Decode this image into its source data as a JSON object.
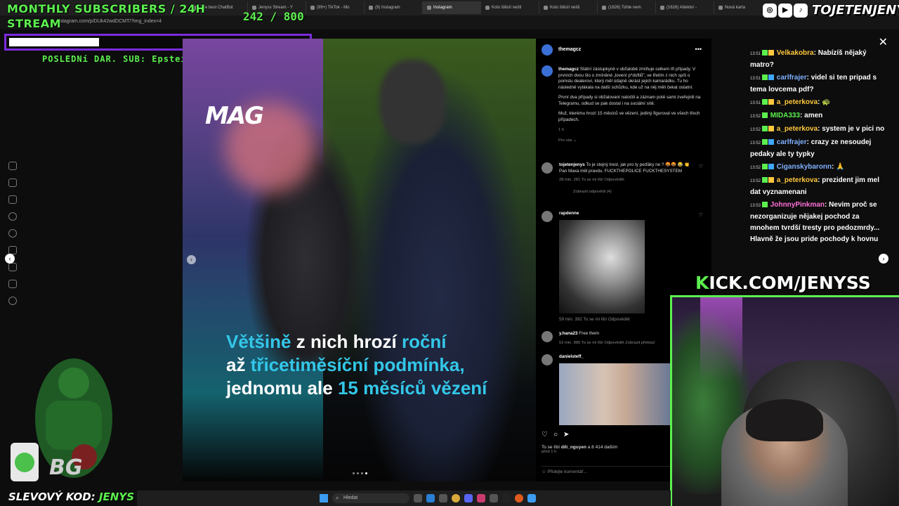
{
  "browser": {
    "tabs": [
      {
        "label": "The best ChatBot",
        "active": false
      },
      {
        "label": "Jenyss Stream - Y",
        "active": false
      },
      {
        "label": "(99+) TikTok - Mo",
        "active": false
      },
      {
        "label": "(9) Instagram",
        "active": false
      },
      {
        "label": "Instagram",
        "active": true
      },
      {
        "label": "Kolo štěstí nešti",
        "active": false
      },
      {
        "label": "Kolo štěstí nešti",
        "active": false
      },
      {
        "label": "(1626) Tohle nem",
        "active": false
      },
      {
        "label": "(1626) Attektor -",
        "active": false
      },
      {
        "label": "Nová karta",
        "active": false
      }
    ],
    "url": "instagram.com/p/DUk42wdDCMT/?img_index=4"
  },
  "overlay": {
    "monthly_title": "MONTHLY SUBSCRIBERS / 24H STREAM",
    "sub_count": "242 / 800",
    "last_donation_label": "POSLEDNí DAR. SUB:",
    "last_donation_user": "EpsteinFanousek",
    "discount_label": "SLEVOVÝ KOD:",
    "discount_code": "JENYS",
    "kick_prefix": "K",
    "kick_url": "ICK.COM/JENYSS",
    "social_handle": "TOJETENJENYS"
  },
  "post": {
    "logo": "MAG",
    "caption_l1_a": "Většině",
    "caption_l1_b": "z nich hrozí",
    "caption_l1_c": "roční",
    "caption_l2_a": "až",
    "caption_l2_b": "třicetiměsíční podmínka,",
    "caption_l3_a": "jednomu ale",
    "caption_l3_b": "15 měsíců vězení"
  },
  "panel": {
    "account": "themagcz",
    "desc_user": "themagcz",
    "desc_p1": "Státní zástupkyně v obžalobě zmiňuje celkem tři případy. V prvních dvou šlo o zmíněné „lovení p*dofilů\", ve třetím z nich spíš o pomstu dealerovi, který měl údajně okrást jejich kamarádku. Tu ho následně vylákala na další schůzku, kde už na něj měli čekat ostatní.",
    "desc_p2": "První dva případy si obžalovaní natočili a záznam poté sami zveřejnili na Telegramu, odkud se pak dostal i na sociální sítě.",
    "desc_p3": "Muž, kterému hrozí 15 měsíců ve vězení, jediný figuroval ve všech třech případech.",
    "desc_time": "1 h",
    "for_you": "Pro vás ⌄",
    "comments": [
      {
        "user": "tojetenjenys",
        "text": "To je stejný trest, jak pro ty peďáky ne ? 🤬🤬 😂 👏 Pan Maxa měl pravdu. FUCKTHEPOLICE FUCKTHESYSTEM",
        "meta": "28 min.   281 To se mi líbí   Odpovědět",
        "replies": "Zobrazit odpovědi (4)"
      },
      {
        "user": "rapdenne",
        "text": "",
        "meta": "59 min.   392 To se mi líbí   Odpovědět"
      },
      {
        "user": "y.hana23",
        "text": "Free them",
        "meta": "52 min.   886 To se mi líbí   Odpovědět   Zobrazit překlad"
      },
      {
        "user": "danielsteff_",
        "text": "",
        "meta": ""
      }
    ],
    "likes_prefix": "To se líbí",
    "likes_user": "dili_nguyen",
    "likes_suffix": "a 8 414 dalším",
    "likes_time": "před 1 h",
    "add_comment_placeholder": "Přidejte komentář..."
  },
  "chat": [
    {
      "time": "13:51",
      "user": "Velkakobra",
      "user_color": "#ffc83d",
      "text": "Nabízíš nějaký matro?"
    },
    {
      "time": "13:51",
      "user": "carlfrajer",
      "user_color": "#7fb0ff",
      "text": "videl si ten pripad s tema lovcema pdf?"
    },
    {
      "time": "13:51",
      "user": "a_peterkova",
      "user_color": "#ffc83d",
      "text": "🐢"
    },
    {
      "time": "13:52",
      "user": "MIDA333",
      "user_color": "#5cf04f",
      "text": "amen"
    },
    {
      "time": "13:52",
      "user": "a_peterkova",
      "user_color": "#ffc83d",
      "text": "system je v pici no"
    },
    {
      "time": "13:52",
      "user": "carlfrajer",
      "user_color": "#7fb0ff",
      "text": "crazy ze nesoudej pedaky ale ty typky"
    },
    {
      "time": "13:52",
      "user": "Ciganskybaronn",
      "user_color": "#7fb0ff",
      "text": "🙏"
    },
    {
      "time": "13:52",
      "user": "a_peterkova",
      "user_color": "#ffc83d",
      "text": "prezident jim mel dat vyznamenani"
    },
    {
      "time": "13:53",
      "user": "JohnnyPinkman",
      "user_color": "#ff6fd8",
      "text": "Nevim proč se nezorganizuje nějakej pochod za mnohem tvrdší tresty pro pedozmrdy... Hlavně že jsou pride pochody k hovnu"
    }
  ],
  "taskbar": {
    "search_placeholder": "Hledat"
  },
  "colors": {
    "accent_green": "#5cf04f",
    "caption_highlight": "#33c7e8",
    "frame_purple": "#7b2bdc"
  }
}
